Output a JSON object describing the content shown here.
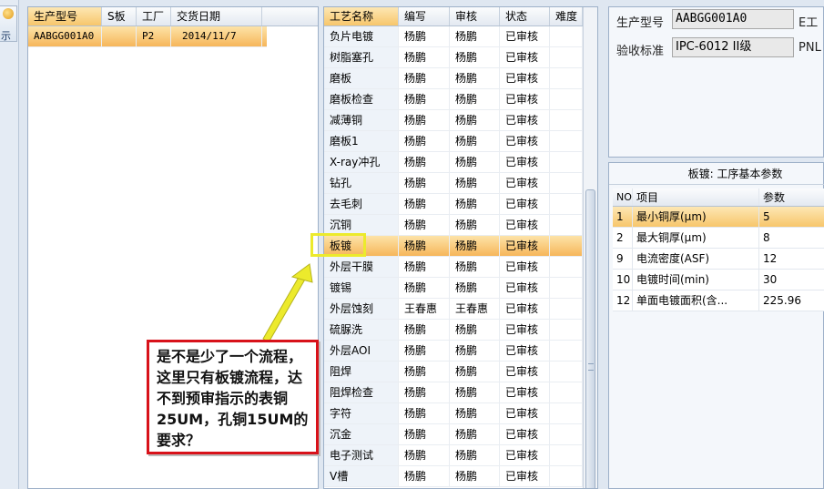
{
  "toolbar": {
    "show_label": "示",
    "show_icon": "show-icon"
  },
  "orders": {
    "columns": [
      "生产型号",
      "S板",
      "工厂",
      "交货日期"
    ],
    "rows": [
      [
        "AABGG001A0",
        "",
        "P2",
        "2014/11/7"
      ]
    ]
  },
  "process": {
    "columns": [
      "工艺名称",
      "编写",
      "审核",
      "状态",
      "难度"
    ],
    "rows": [
      [
        "负片电镀",
        "杨鹏",
        "杨鹏",
        "已审核",
        ""
      ],
      [
        "树脂塞孔",
        "杨鹏",
        "杨鹏",
        "已审核",
        ""
      ],
      [
        "磨板",
        "杨鹏",
        "杨鹏",
        "已审核",
        ""
      ],
      [
        "磨板检查",
        "杨鹏",
        "杨鹏",
        "已审核",
        ""
      ],
      [
        "减薄铜",
        "杨鹏",
        "杨鹏",
        "已审核",
        ""
      ],
      [
        "磨板1",
        "杨鹏",
        "杨鹏",
        "已审核",
        ""
      ],
      [
        "X-ray冲孔",
        "杨鹏",
        "杨鹏",
        "已审核",
        ""
      ],
      [
        "钻孔",
        "杨鹏",
        "杨鹏",
        "已审核",
        ""
      ],
      [
        "去毛刺",
        "杨鹏",
        "杨鹏",
        "已审核",
        ""
      ],
      [
        "沉铜",
        "杨鹏",
        "杨鹏",
        "已审核",
        ""
      ],
      [
        "板镀",
        "杨鹏",
        "杨鹏",
        "已审核",
        ""
      ],
      [
        "外层干膜",
        "杨鹏",
        "杨鹏",
        "已审核",
        ""
      ],
      [
        "镀锡",
        "杨鹏",
        "杨鹏",
        "已审核",
        ""
      ],
      [
        "外层蚀刻",
        "王春惠",
        "王春惠",
        "已审核",
        ""
      ],
      [
        "硫脲洗",
        "杨鹏",
        "杨鹏",
        "已审核",
        ""
      ],
      [
        "外层AOI",
        "杨鹏",
        "杨鹏",
        "已审核",
        ""
      ],
      [
        "阻焊",
        "杨鹏",
        "杨鹏",
        "已审核",
        ""
      ],
      [
        "阻焊检查",
        "杨鹏",
        "杨鹏",
        "已审核",
        ""
      ],
      [
        "字符",
        "杨鹏",
        "杨鹏",
        "已审核",
        ""
      ],
      [
        "沉金",
        "杨鹏",
        "杨鹏",
        "已审核",
        ""
      ],
      [
        "电子测试",
        "杨鹏",
        "杨鹏",
        "已审核",
        ""
      ],
      [
        "V槽",
        "杨鹏",
        "杨鹏",
        "已审核",
        ""
      ]
    ],
    "selected_index": 10
  },
  "info": {
    "model_label": "生产型号",
    "model_value": "AABGG001A0",
    "model_extra": "E工",
    "standard_label": "验收标准",
    "standard_value": "IPC-6012 II级",
    "standard_extra": "PNL"
  },
  "params": {
    "title": "板镀: 工序基本参数",
    "columns": [
      "NO",
      "项目",
      "参数"
    ],
    "rows": [
      [
        "1",
        "最小铜厚(μm)",
        "5"
      ],
      [
        "2",
        "最大铜厚(μm)",
        "8"
      ],
      [
        "9",
        "电流密度(ASF)",
        "12"
      ],
      [
        "10",
        "电镀时间(min)",
        "30"
      ],
      [
        "12",
        "单面电镀面积(含...",
        "225.96"
      ]
    ]
  },
  "annotation": {
    "callout_text": "是不是少了一个流程，这里只有板镀流程，达不到预审指示的表铜25UM，孔铜15UM的要求？",
    "box_color": "#ecea2c",
    "arrow_color": "#ecea2c",
    "callout_border": "#d8121a"
  }
}
